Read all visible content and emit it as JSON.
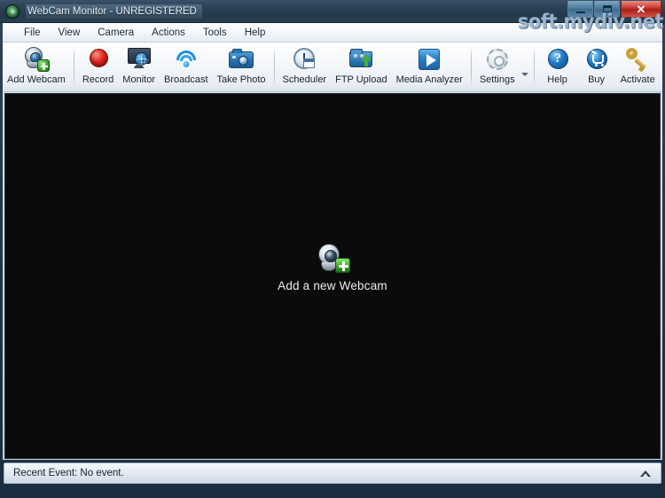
{
  "window": {
    "title": "WebCam Monitor - UNREGISTERED",
    "app_icon": "webcam-icon",
    "watermark": "soft.mydiv.net",
    "controls": {
      "minimize": "minimize-button",
      "maximize": "maximize-button",
      "close_label": "✕"
    }
  },
  "menubar": {
    "items": [
      {
        "label": "File"
      },
      {
        "label": "View"
      },
      {
        "label": "Camera"
      },
      {
        "label": "Actions"
      },
      {
        "label": "Tools"
      },
      {
        "label": "Help"
      }
    ]
  },
  "toolbar": {
    "buttons": [
      {
        "label": "Add Webcam",
        "icon": "add-webcam-icon"
      },
      {
        "label": "Record",
        "icon": "record-icon"
      },
      {
        "label": "Monitor",
        "icon": "monitor-globe-icon"
      },
      {
        "label": "Broadcast",
        "icon": "wifi-broadcast-icon"
      },
      {
        "label": "Take Photo",
        "icon": "camera-icon"
      },
      {
        "label": "Scheduler",
        "icon": "clock-calendar-icon"
      },
      {
        "label": "FTP Upload",
        "icon": "ftp-upload-icon"
      },
      {
        "label": "Media Analyzer",
        "icon": "media-play-icon"
      },
      {
        "label": "Settings",
        "icon": "gear-icon"
      },
      {
        "label": "Help",
        "icon": "help-question-icon"
      },
      {
        "label": "Buy",
        "icon": "shopping-cart-icon"
      },
      {
        "label": "Activate",
        "icon": "key-icon"
      }
    ],
    "settings_dropdown": "chevron-down-icon"
  },
  "main": {
    "video_placeholder_background": "#0b0b0b",
    "cta": {
      "label": "Add a new Webcam",
      "icon": "add-webcam-icon"
    }
  },
  "statusbar": {
    "text": "Recent Event: No event.",
    "expand_icon": "chevron-up-icon"
  },
  "colors": {
    "title_bar": "#2c4257",
    "toolbar_bg": "#f4f7fa",
    "video_bg": "#0b0b0b",
    "accent_blue": "#1f78c4",
    "record_red": "#e02a20",
    "plus_green": "#3da32c",
    "close_red": "#c9352b"
  }
}
